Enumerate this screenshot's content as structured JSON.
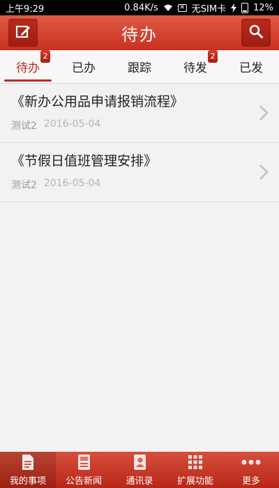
{
  "status_bar": {
    "time": "上午9:29",
    "speed": "0.84K/s",
    "carrier": "无SIM卡",
    "battery": "12%",
    "icons": [
      "wifi-icon",
      "no-sim-icon",
      "charging-icon",
      "battery-icon"
    ]
  },
  "header": {
    "title": "待办",
    "left_icon": "compose-icon",
    "right_icon": "search-icon"
  },
  "tabs": [
    {
      "label": "待办",
      "badge": "2",
      "active": true
    },
    {
      "label": "已办",
      "badge": "",
      "active": false
    },
    {
      "label": "跟踪",
      "badge": "",
      "active": false
    },
    {
      "label": "待发",
      "badge": "2",
      "active": false
    },
    {
      "label": "已发",
      "badge": "",
      "active": false
    }
  ],
  "items": [
    {
      "title": "《新办公用品申请报销流程》",
      "author": "测试2",
      "date": "2016-05-04"
    },
    {
      "title": "《节假日值班管理安排》",
      "author": "测试2",
      "date": "2016-05-04"
    }
  ],
  "bottom_nav": [
    {
      "label": "我的事项",
      "icon": "document-icon",
      "active": true
    },
    {
      "label": "公告新闻",
      "icon": "news-icon",
      "active": false
    },
    {
      "label": "通讯录",
      "icon": "contacts-icon",
      "active": false
    },
    {
      "label": "扩展功能",
      "icon": "grid-icon",
      "active": false
    },
    {
      "label": "更多",
      "icon": "more-icon",
      "active": false
    }
  ],
  "colors": {
    "brand_red": "#c9301f",
    "active_tab": "#c0281a",
    "background": "#f2f2f2"
  }
}
